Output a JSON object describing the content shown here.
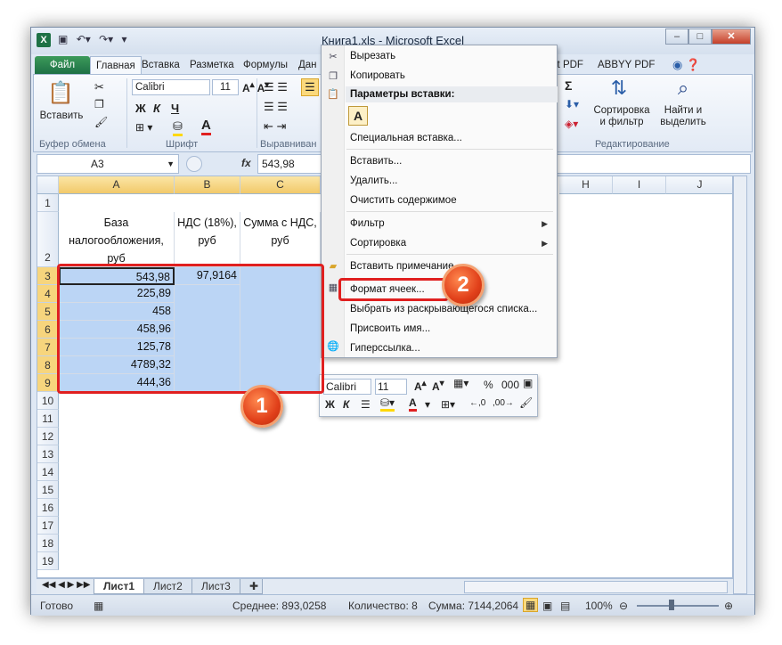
{
  "title": "Книга1.xls  -  Microsoft Excel",
  "tabs": [
    "Файл",
    "Главная",
    "Вставка",
    "Разметка",
    "Формулы",
    "Дан",
    "it PDF",
    "ABBYY PDF"
  ],
  "ribbon": {
    "paste": "Вставить",
    "clipboard": "Буфер обмена",
    "font_group": "Шрифт",
    "font_name": "Calibri",
    "font_size": "11",
    "bold": "Ж",
    "italic": "К",
    "underline": "Ч",
    "align_group": "Выравниван",
    "sort_filter": "Сортировка\nи фильтр",
    "find_select": "Найти и\nвыделить",
    "editing_group": "Редактирование",
    "sigma": "Σ"
  },
  "formula_bar": {
    "name_box": "A3",
    "fx": "fx",
    "value": "543,98"
  },
  "columns": [
    "A",
    "B",
    "C",
    "H",
    "I",
    "J"
  ],
  "rows": [
    "1",
    "2",
    "3",
    "4",
    "5",
    "6",
    "7",
    "8",
    "9",
    "10",
    "11",
    "12",
    "13",
    "14",
    "15",
    "16",
    "17",
    "18",
    "19"
  ],
  "header_cells": {
    "a2": "База налогообложения, руб",
    "b2": "НДС (18%), руб",
    "c2": "Сумма с НДС, руб"
  },
  "values_a": [
    "543,98",
    "225,89",
    "458",
    "458,96",
    "125,78",
    "4789,32",
    "444,36"
  ],
  "values_b": [
    "97,9164"
  ],
  "sheet_tabs": [
    "Лист1",
    "Лист2",
    "Лист3"
  ],
  "status": {
    "ready": "Готово",
    "average": "Среднее: 893,0258",
    "count": "Количество: 8",
    "sum": "Сумма: 7144,2064",
    "zoom": "100%"
  },
  "context_menu": {
    "cut": "Вырезать",
    "copy": "Копировать",
    "paste_options": "Параметры вставки:",
    "paste_a": "A",
    "special_paste": "Специальная вставка...",
    "insert": "Вставить...",
    "delete": "Удалить...",
    "clear": "Очистить содержимое",
    "filter": "Фильтр",
    "sort": "Сортировка",
    "insert_note": "Вставить примечание",
    "format_cells": "Формат ячеек...",
    "pick_list": "Выбрать из раскрывающегося списка...",
    "assign_name": "Присвоить имя...",
    "hyperlink": "Гиперссылка..."
  },
  "mini_toolbar": {
    "font": "Calibri",
    "size": "11",
    "percent": "%",
    "thousands": "000"
  },
  "badges": [
    "1",
    "2"
  ]
}
